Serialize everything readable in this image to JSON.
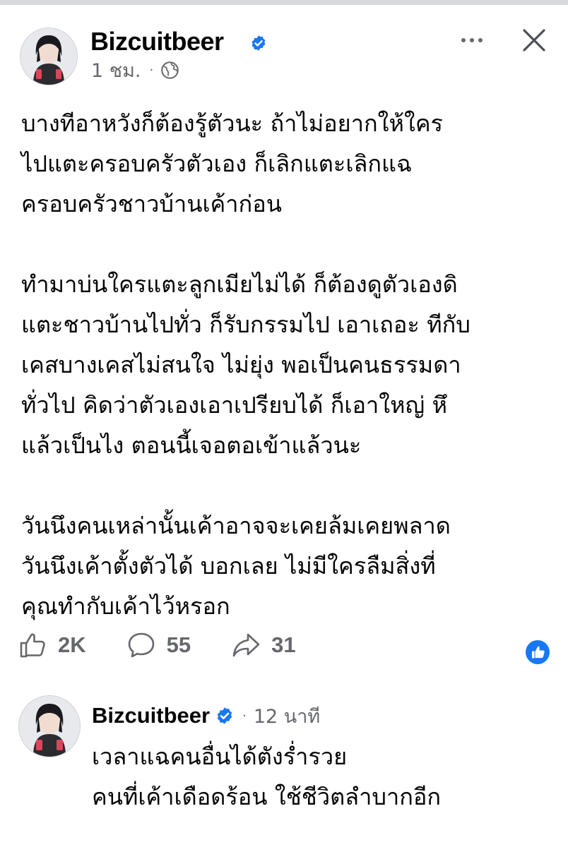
{
  "post": {
    "author": "Bizcuitbeer",
    "time": "1 ชม.",
    "separator": "·",
    "icons": {
      "verified": "verified-badge-icon",
      "privacy": "globe-icon",
      "more": "more-icon",
      "close": "close-icon"
    },
    "paragraphs": [
      "บางทีอาหวังก็ต้องรู้ตัวนะ ถ้าไม่อยากให้ใคร\nไปแตะครอบครัวตัวเอง ก็เลิกแตะเลิกแฉ\nครอบครัวชาวบ้านเค้าก่อน",
      "ทำมาบ่นใครแตะลูกเมียไม่ได้ ก็ต้องดูตัวเองดิ\nแตะชาวบ้านไปทั่ว ก็รับกรรมไป เอาเถอะ ทีกับ\nเคสบางเคสไม่สนใจ ไม่ยุ่ง พอเป็นคนธรรมดา\nทั่วไป คิดว่าตัวเองเอาเปรียบได้ ก็เอาใหญ่ หึ\nแล้วเป็นไง ตอนนี้เจอตอเข้าแล้วนะ",
      "วันนึงคนเหล่านั้นเค้าอาจจะเคยล้มเคยพลาด\nวันนึงเค้าตั้งตัวได้ บอกเลย ไม่มีใครลืมสิ่งที่\nคุณทำกับเค้าไว้หรอก"
    ],
    "stats": {
      "likes": "2K",
      "comments": "55",
      "shares": "31"
    },
    "colors": {
      "verified": "#1877f2",
      "secondary_text": "#65676b",
      "primary_text": "#050505"
    }
  },
  "comment": {
    "author": "Bizcuitbeer",
    "separator": "·",
    "time": "12 นาที",
    "text": "เวลาแฉคนอื่นได้ตังร่ำรวย\nคนที่เค้าเดือดร้อน ใช้ชีวิตลำบากอีก"
  }
}
